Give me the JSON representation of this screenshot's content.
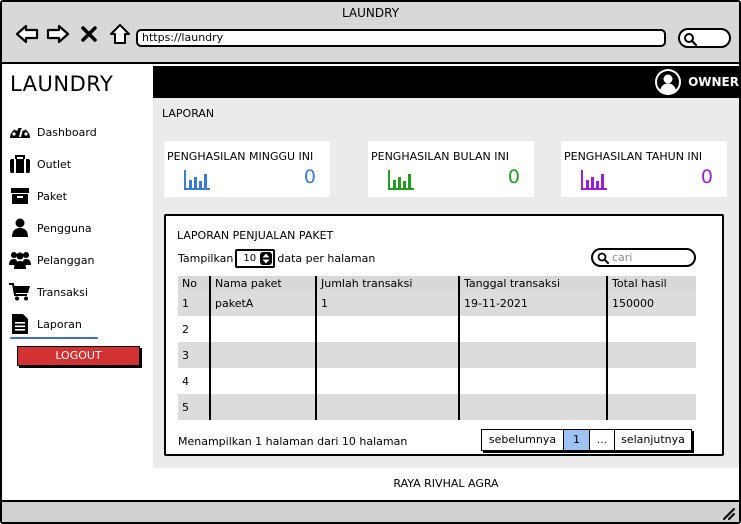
{
  "window": {
    "title": "LAUNDRY",
    "url": "https://laundry"
  },
  "brand": "LAUNDRY",
  "sidebar": {
    "items": [
      {
        "label": "Dashboard",
        "icon": "dashboard-icon"
      },
      {
        "label": "Outlet",
        "icon": "briefcase-icon"
      },
      {
        "label": "Paket",
        "icon": "archive-icon"
      },
      {
        "label": "Pengguna",
        "icon": "user-icon"
      },
      {
        "label": "Pelanggan",
        "icon": "users-icon"
      },
      {
        "label": "Transaksi",
        "icon": "cart-icon"
      },
      {
        "label": "Laporan",
        "icon": "document-icon",
        "active": true
      }
    ],
    "logout_label": "LOGOUT"
  },
  "topbar": {
    "user": "OWNER"
  },
  "page_title": "LAPORAN",
  "cards": [
    {
      "label": "PENGHASILAN MINGGU INI",
      "value": "0",
      "color": "#3a7ad8"
    },
    {
      "label": "PENGHASILAN BULAN INI",
      "value": "0",
      "color": "#1ea01e"
    },
    {
      "label": "PENGHASILAN TAHUN INI",
      "value": "0",
      "color": "#9a1ed8"
    }
  ],
  "report": {
    "title": "LAPORAN PENJUALAN PAKET",
    "show_label": "Tampilkan",
    "page_size": "10",
    "per_page_label": "data per halaman",
    "search_placeholder": "cari",
    "columns": [
      "No",
      "Nama paket",
      "Jumlah transaksi",
      "Tanggal transaksi",
      "Total hasil"
    ],
    "rows": [
      [
        "1",
        "paketA",
        "1",
        "19-11-2021",
        "150000"
      ],
      [
        "2",
        "",
        "",
        "",
        ""
      ],
      [
        "3",
        "",
        "",
        "",
        ""
      ],
      [
        "4",
        "",
        "",
        "",
        ""
      ],
      [
        "5",
        "",
        "",
        "",
        ""
      ]
    ],
    "info": "Menampilkan 1 halaman dari 10 halaman",
    "pager": {
      "prev": "sebelumnya",
      "current": "1",
      "ellipsis": "...",
      "next": "selanjutnya"
    }
  },
  "footer": "RAYA RIVHAL AGRA"
}
